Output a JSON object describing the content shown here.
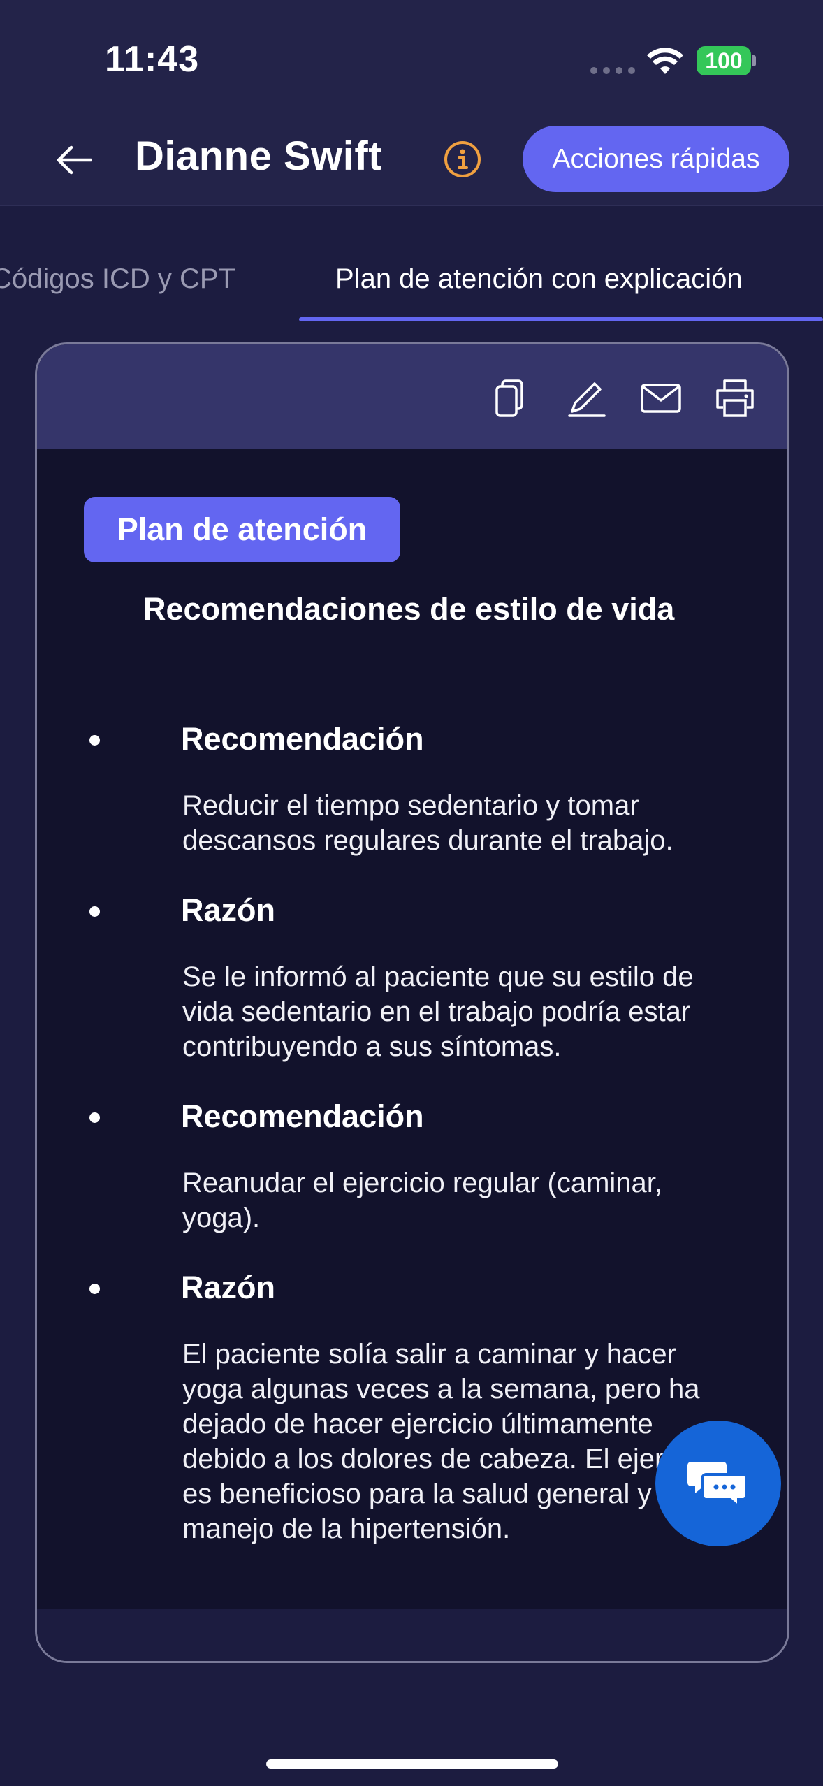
{
  "status_bar": {
    "time": "11:43",
    "battery": "100",
    "icons": [
      "signal-dots-icon",
      "wifi-icon",
      "battery-icon"
    ]
  },
  "header": {
    "title": "Dianne Swift",
    "back_icon": "arrow-left-icon",
    "info_icon": "info-icon",
    "quick_actions_label": "Acciones rápidas"
  },
  "tabs": [
    {
      "label": "Códigos ICD y CPT",
      "selected": false
    },
    {
      "label": "Plan de atención con explicación",
      "selected": true
    }
  ],
  "toolbar": {
    "icons": [
      "copy-icon",
      "edit-icon",
      "mail-icon",
      "print-icon"
    ]
  },
  "care_plan": {
    "badge": "Plan de atención",
    "section_title": "Recomendaciones de estilo de vida",
    "items": [
      {
        "label": "Recomendación",
        "text": "Reducir el tiempo sedentario y tomar descansos regulares durante el trabajo."
      },
      {
        "label": "Razón",
        "text": "Se le informó al paciente que su estilo de vida sedentario en el trabajo podría estar contribuyendo a sus síntomas."
      },
      {
        "label": "Recomendación",
        "text": "Reanudar el ejercicio regular (caminar, yoga)."
      },
      {
        "label": "Razón",
        "text": "El paciente solía salir a caminar y hacer yoga algunas veces a la semana, pero ha dejado de hacer ejercicio últimamente debido a los dolores de cabeza. El ejercicio es beneficioso para la salud general y el manejo de la hipertensión."
      }
    ]
  },
  "chat_button": {
    "icon": "chat-bubbles-icon"
  },
  "colors": {
    "accent": "#6366f1",
    "background": "#1c1c40",
    "header": "#232349",
    "card_body": "#12122c",
    "card_toolbar": "#35356a",
    "chat_fab": "#1565d8",
    "info_icon": "#f0a040",
    "battery": "#34c759"
  }
}
